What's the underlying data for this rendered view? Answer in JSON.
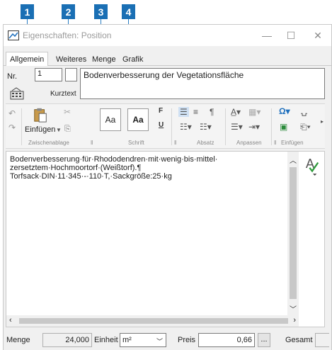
{
  "callouts": [
    "1",
    "2",
    "3",
    "4"
  ],
  "window": {
    "title": "Eigenschaften: Position",
    "controls": {
      "minimize": "—",
      "maximize": "☐",
      "close": "✕"
    }
  },
  "tabs": [
    {
      "label": "Allgemein",
      "active": true
    },
    {
      "label": "Weiteres",
      "active": false
    },
    {
      "label": "Menge",
      "active": false
    },
    {
      "label": "Grafik",
      "active": false
    }
  ],
  "position": {
    "nr_label": "Nr.",
    "nr_value": "1",
    "short_text": "Bodenverbesserung der Vegetationsfläche",
    "kurztext_label": "Kurztext"
  },
  "ribbon": {
    "groups": {
      "clipboard": "Zwischenablage",
      "font": "Schrift",
      "paragraph": "Absatz",
      "adjust": "Anpassen",
      "insert": "Einfügen"
    },
    "paste_label": "Einfügen",
    "style_buttons": [
      "Aa",
      "Aa"
    ],
    "font_letters": [
      "F",
      "U"
    ]
  },
  "editor": {
    "lines": [
      "Bodenverbesserung·für·Rhododendren·mit·wenig·bis·mittel·",
      "zersetztem·Hochmoortorf·(Weißtorf).¶",
      "Torfsack·DIN·11·345·-·110·T,·Sackgröße:25·kg"
    ]
  },
  "bottom": {
    "menge_label": "Menge",
    "menge_value": "24,000",
    "einheit_label": "Einheit",
    "einheit_value": "m²",
    "preis_label": "Preis",
    "preis_value": "0,66",
    "ellipsis": "...",
    "gesamt_label": "Gesamt"
  },
  "colors": {
    "callout": "#1a6fb4",
    "accent": "#1e6fbd"
  }
}
